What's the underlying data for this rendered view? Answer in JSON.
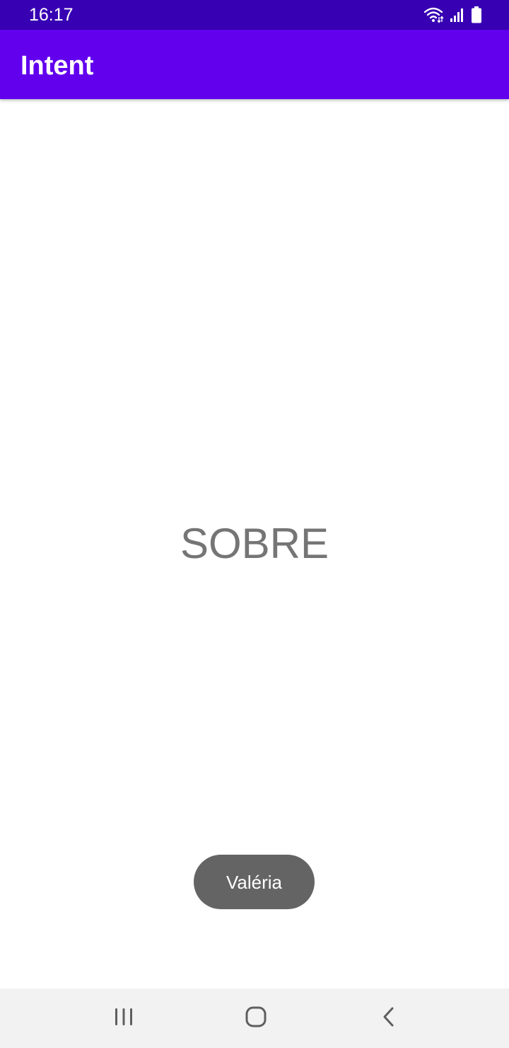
{
  "status_bar": {
    "time": "16:17",
    "icons": [
      "wifi-icon",
      "signal-icon",
      "battery-icon"
    ],
    "background": "#3700b3"
  },
  "app_bar": {
    "title": "Intent",
    "background": "#6200ee"
  },
  "main": {
    "label": "SOBRE",
    "label_color": "#757575"
  },
  "toast": {
    "message": "Valéria",
    "background": "#646464"
  },
  "nav_bar": {
    "buttons": [
      "recents-icon",
      "home-icon",
      "back-icon"
    ],
    "background": "#f2f2f2"
  }
}
